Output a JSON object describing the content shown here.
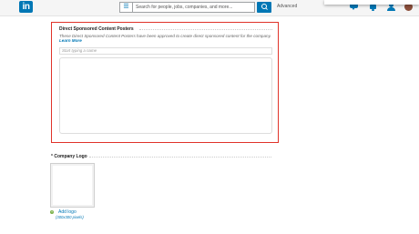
{
  "header": {
    "logo_text": "in",
    "search_menu_icon": "list-icon",
    "search_placeholder": "Search for people, jobs, companies, and more...",
    "advanced_label": "Advanced",
    "icons": [
      "messages-icon",
      "notifications-icon",
      "add-connections-icon",
      "profile-avatar"
    ]
  },
  "sponsored_posters": {
    "title": "Direct Sponsored Content Posters",
    "description": "These Direct Sponsored Content Posters have been approved to create direct sponsored content for the company.",
    "learn_more": "Learn More",
    "input_placeholder": "Start typing a name"
  },
  "company_logo": {
    "required_marker": "*",
    "label": "Company Logo",
    "add_label": "Add logo",
    "size_hint": "(300x300 pixels)"
  },
  "colors": {
    "brand": "#0077b5",
    "highlight_border": "#e0332a",
    "add_icon": "#7bb24b"
  }
}
